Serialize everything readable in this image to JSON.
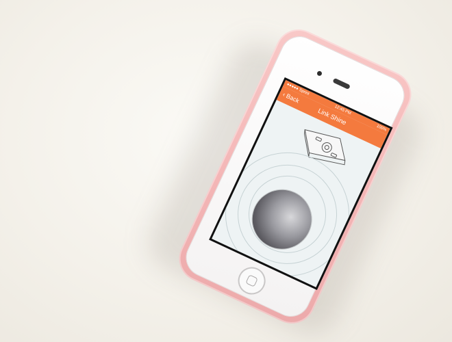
{
  "scene": {
    "description_colors": {
      "background": "#f4f1ea",
      "case": "#f4b7b7",
      "accent": "#f47a3e",
      "sensor": "#6a6970"
    }
  },
  "app": {
    "status": {
      "carrier": "●●●●● Sprint",
      "time": "12:45 PM",
      "battery": "100%"
    },
    "nav": {
      "back_label": "‹ Back",
      "title": "Link Shine"
    },
    "icons": {
      "device": "device-illustration-icon",
      "sensor": "sensor-disc"
    }
  }
}
